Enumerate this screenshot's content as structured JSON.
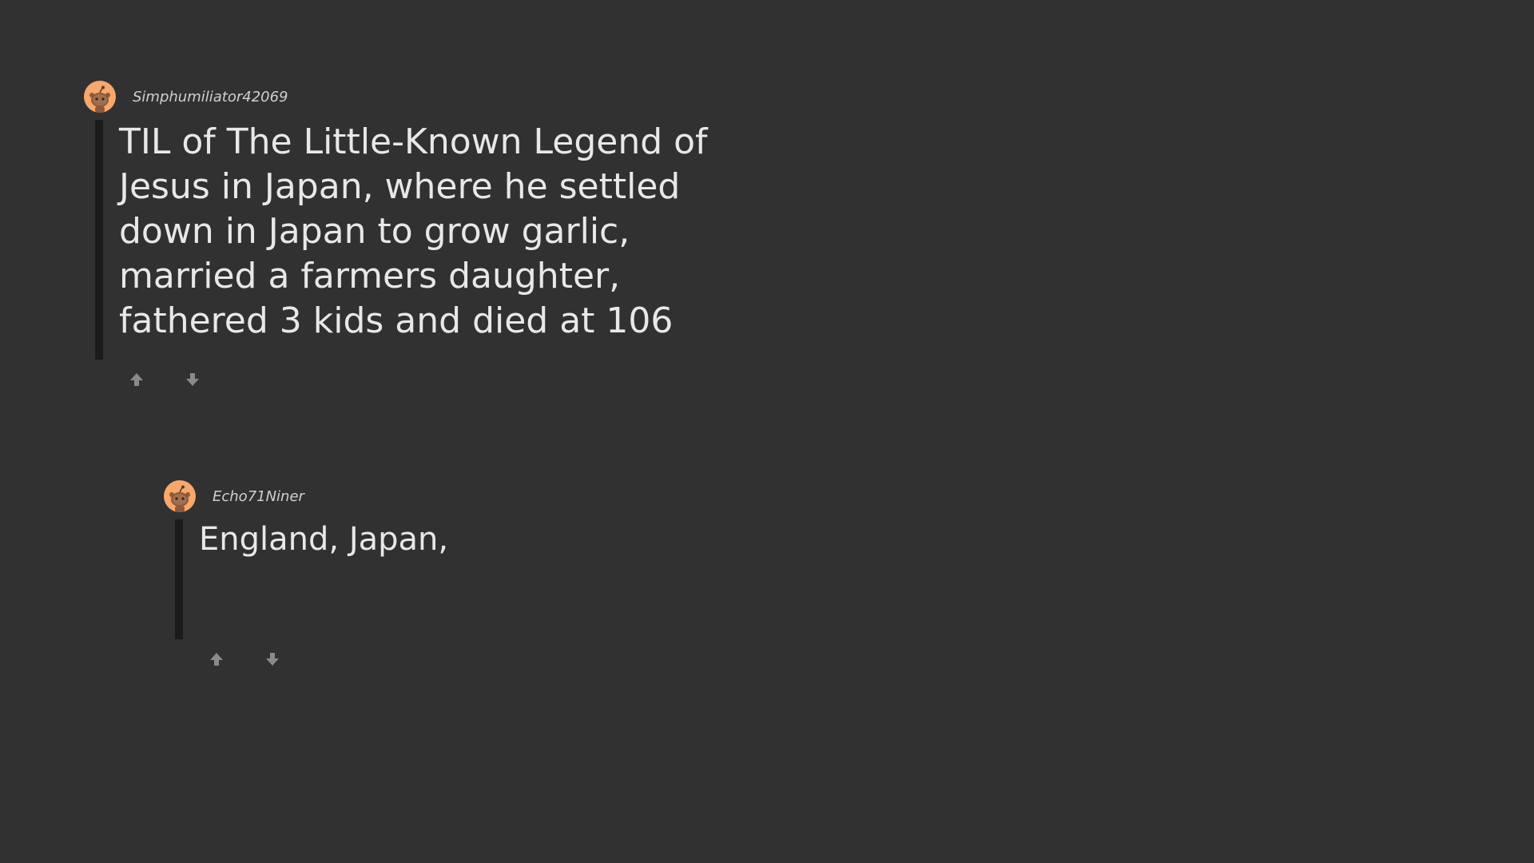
{
  "comments": [
    {
      "username": "Simphumiliator42069",
      "text": "TIL of The Little-Known Legend of\nJesus in Japan, where he settled\ndown in Japan to grow garlic,\nmarried a farmers daughter,\nfathered 3 kids and died at 106",
      "avatar_icon": "reddit-snoo-avatar-icon",
      "upvote_icon": "upvote-arrow-icon",
      "downvote_icon": "downvote-arrow-icon"
    },
    {
      "username": "Echo71Niner",
      "text": "England, Japan,",
      "avatar_icon": "reddit-snoo-avatar-icon",
      "upvote_icon": "upvote-arrow-icon",
      "downvote_icon": "downvote-arrow-icon"
    }
  ],
  "colors": {
    "background": "#313131",
    "avatar_bg": "#f7a86a",
    "thread_line": "#1b1b1b",
    "vote_icon": "#8a8a8a",
    "text": "#e8e8e8"
  }
}
